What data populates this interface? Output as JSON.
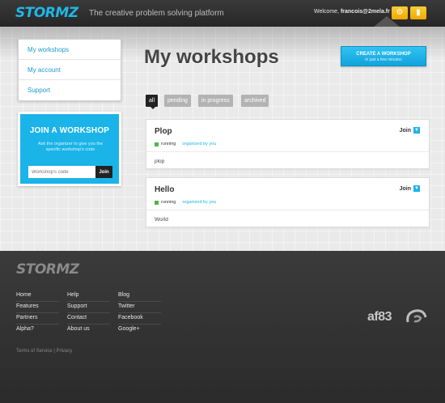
{
  "header": {
    "logo": "STORMZ",
    "tagline": "The creative problem solving platform",
    "welcome_prefix": "Welcome,",
    "user_email": "francois@2mela.fr",
    "settings_icon": "gear-icon",
    "logout_icon": "door-icon"
  },
  "sidebar": {
    "items": [
      {
        "label": "My workshops"
      },
      {
        "label": "My account"
      },
      {
        "label": "Support"
      }
    ]
  },
  "join": {
    "title": "JOIN A WORKSHOP",
    "description": "Ask the organizer to give you the specific workshop's code",
    "placeholder": "Workshop's code",
    "button": "Join"
  },
  "main": {
    "title": "My workshops",
    "create_button": "CREATE A WORKSHOP",
    "create_sub": "in just a few minutes"
  },
  "filters": [
    {
      "label": "all",
      "active": true
    },
    {
      "label": "pending",
      "active": false
    },
    {
      "label": "in progress",
      "active": false
    },
    {
      "label": "archived",
      "active": false
    }
  ],
  "workshops": [
    {
      "title": "Plop",
      "status": "running",
      "owner": "organized by you",
      "description": "plop",
      "join": "Join"
    },
    {
      "title": "Hello",
      "status": "running",
      "owner": "organized by you",
      "description": "World",
      "join": "Join"
    }
  ],
  "footer": {
    "logo": "STORMZ",
    "columns": [
      [
        "Home",
        "Features",
        "Partners",
        "Alpha?"
      ],
      [
        "Help",
        "Support",
        "Contact",
        "About us"
      ],
      [
        "Blog",
        "Twitter",
        "Facebook",
        "Google+"
      ]
    ],
    "terms": "Terms of Service",
    "separator": "|",
    "privacy": "Privacy",
    "partner": "af83"
  },
  "colors": {
    "accent": "#1ab4e8",
    "header_bg": "#2b2b2b",
    "header_button": "#f5b400",
    "status_running": "#4cb848"
  }
}
